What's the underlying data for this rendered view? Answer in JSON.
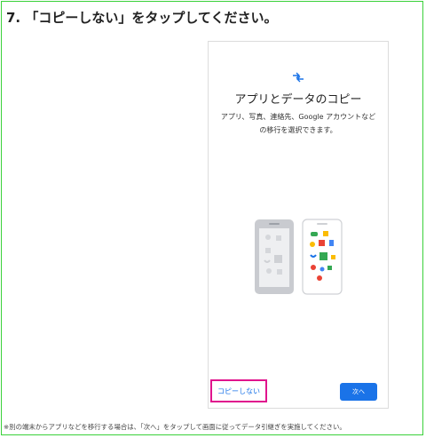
{
  "step": {
    "title": "7. 「コピーしない」をタップしてください。"
  },
  "screen": {
    "icon": "transfer-arrows-icon",
    "title": "アプリとデータのコピー",
    "description_line1": "アプリ、写真、連絡先、Google アカウントなど",
    "description_line2": "の移行を選択できます。",
    "illustration": "two-phones-transfer-illustration",
    "copy_none_label": "コピーしない",
    "next_label": "次へ"
  },
  "footnote": "※別の端末からアプリなどを移行する場合は、「次へ」をタップして画面に従ってデータ引継ぎを実施してください。",
  "colors": {
    "frame": "#3ad13a",
    "highlight": "#e0148d",
    "accent": "#1a73e8"
  }
}
